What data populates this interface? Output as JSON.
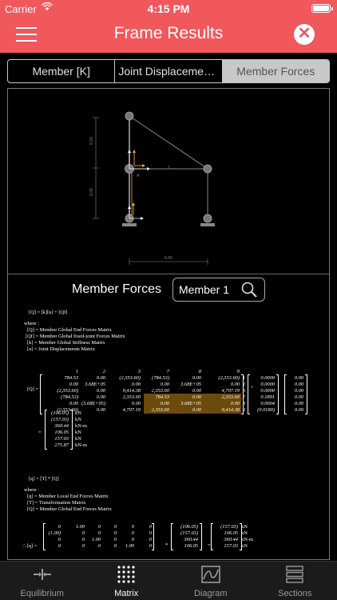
{
  "status": {
    "carrier": "Carrier",
    "time": "4:15 PM"
  },
  "header": {
    "title": "Frame Results"
  },
  "segments": [
    "Member [K]",
    "Joint Displacement...",
    "Member Forces"
  ],
  "section": {
    "label": "Member Forces",
    "member_value": "Member 1"
  },
  "diagram": {
    "dim_left_top": "6.00",
    "dim_left_bottom": "6.00",
    "dim_bottom": "6.00",
    "member_label": "1",
    "joint_a": "A"
  },
  "eq1": {
    "equation": "[Q]  =  [k][u] + [Qf]",
    "where": "where  :",
    "defs": [
      "[Q]  =  Member Global End Forces Matrix",
      "[Qf]  =  Member Global fixed-joint Forces Matrix",
      "[k]  =  Member Global Stiffness Matrix",
      "[u]  =  Joint Displacements Matrix"
    ],
    "q_label": "[Q]  =",
    "col_headers": [
      "1",
      "2",
      "3",
      "7",
      "8",
      "9"
    ],
    "rows": [
      [
        "784.53",
        "0.00",
        "(2,353.60)",
        "(784.53)",
        "0.00",
        "(2,353.60)"
      ],
      [
        "0.00",
        "3.68E+05",
        "0.00",
        "0.00",
        "3.68E+05",
        "0.00"
      ],
      [
        "(2,353.60)",
        "0.00",
        "9,414.38",
        "2,353.60",
        "0.00",
        "4,707.19"
      ],
      [
        "(784.53)",
        "0.00",
        "2,353.60",
        "784.53",
        "0.00",
        "2,353.60"
      ],
      [
        "0.00",
        "(3.68E+05)",
        "0.00",
        "0.00",
        "3.68E+05",
        "0.00"
      ],
      [
        "(2,353.60)",
        "0.00",
        "4,707.19",
        "2,353.60",
        "0.00",
        "9,414.38"
      ]
    ],
    "row_idx": [
      "1",
      "2",
      "3",
      "7",
      "8",
      "9"
    ],
    "u": [
      "0.0000",
      "0.0000",
      "0.0000",
      "0.1891",
      "0.0004",
      "(0.0180)"
    ],
    "plus": "+",
    "qf": [
      "0.00",
      "0.00",
      "0.00",
      "0.00",
      "0.00",
      "0.00"
    ],
    "eq": "=",
    "result": [
      "(106.05)",
      "(157.03)",
      "360.44",
      "106.05",
      "157.03",
      "275.87"
    ],
    "units": [
      "kN",
      "kN",
      "kN-m",
      "kN",
      "kN",
      "kN-m"
    ]
  },
  "eq2": {
    "equation": "[q]  =  [T] * [Q]",
    "where": "where  :",
    "defs": [
      "[q]  =  Member Local End Forces Matrix",
      "[T]  =  Transformation Matrix",
      "[Q]  =  Member Global End Forces Matrix"
    ],
    "q_label": "∴ [q]  =",
    "t_rows": [
      [
        "0",
        "1.00",
        "0",
        "0",
        "0",
        "0"
      ],
      [
        "(1.00)",
        "0",
        "0",
        "0",
        "0",
        "0"
      ],
      [
        "0",
        "0",
        "1.00",
        "0",
        "0",
        "0"
      ],
      [
        "0",
        "0",
        "0",
        "0",
        "1.00",
        "0"
      ]
    ],
    "times": "*",
    "Q": [
      "(106.05)",
      "(157.03)",
      "360.44",
      "106.05"
    ],
    "eq": "=",
    "q": [
      "(157.03)",
      "106.05",
      "360.44",
      "157.03"
    ],
    "units": [
      "kN",
      "kN",
      "kN-m",
      "kN"
    ]
  },
  "tabs": [
    {
      "label": "Equilibrium",
      "icon": "equilibrium-icon"
    },
    {
      "label": "Matrix",
      "icon": "matrix-icon"
    },
    {
      "label": "Diagram",
      "icon": "diagram-icon"
    },
    {
      "label": "Sections",
      "icon": "sections-icon"
    }
  ],
  "colors": {
    "header": "#f0585c",
    "highlight": "#6b4a0a",
    "accent": "#f5a623"
  }
}
